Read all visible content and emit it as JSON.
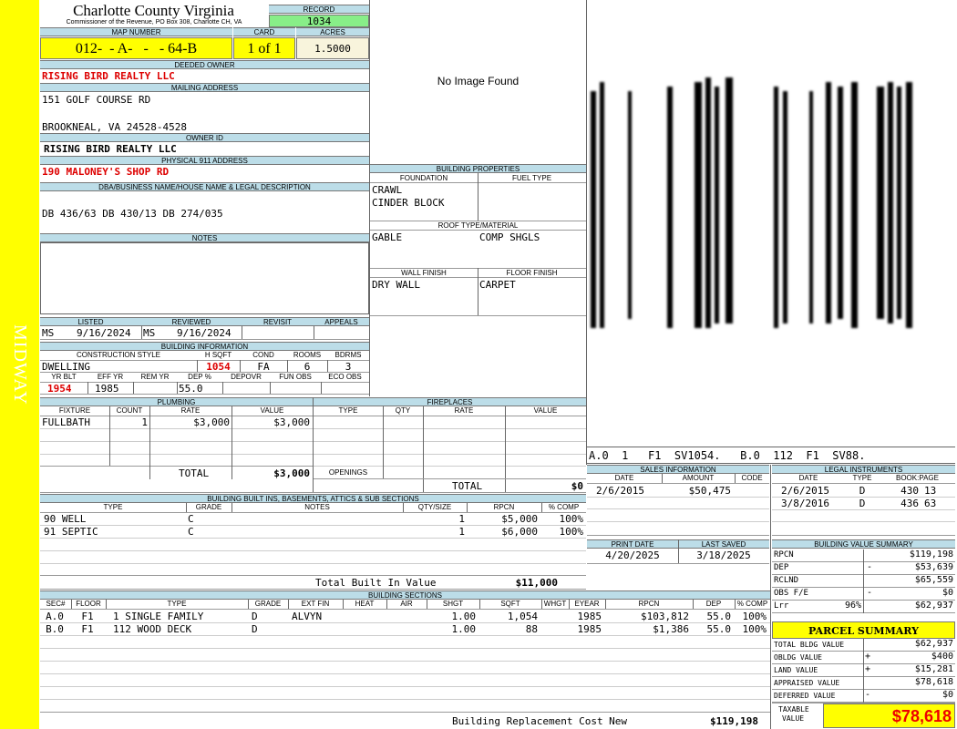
{
  "side_label": "MIDWAY",
  "header": {
    "county": "Charlotte County Virginia",
    "subtitle": "Commissioner of the Revenue, PO Box 308, Charlotte CH, VA",
    "record_label": "RECORD",
    "record": "1034",
    "map_label": "MAP NUMBER",
    "map_number": "012-  - A-   -   - 64-B",
    "card_label": "CARD",
    "card": "1 of 1",
    "acres_label": "ACRES",
    "acres": "1.5000"
  },
  "owner": {
    "deeded_label": "DEEDED OWNER",
    "deeded": "RISING BIRD REALTY LLC",
    "mailing_label": "MAILING ADDRESS",
    "mailing_line1": "151 GOLF COURSE RD",
    "mailing_line2": "BROOKNEAL, VA 24528-4528",
    "owner_id_label": "OWNER ID",
    "owner_id": "RISING BIRD REALTY LLC",
    "physical_label": "PHYSICAL 911 ADDRESS",
    "physical": "190 MALONEY'S SHOP RD",
    "dba_label": "DBA/BUSINESS NAME/HOUSE NAME & LEGAL DESCRIPTION",
    "dba": "DB 436/63 DB 430/13 DB 274/035",
    "notes_label": "NOTES",
    "notes": ""
  },
  "image": {
    "placeholder": "No Image Found"
  },
  "sketch": {
    "caption": "A.0  1   F1  SV1054.   B.0  112  F1  SV88."
  },
  "building_properties": {
    "title": "BUILDING PROPERTIES",
    "foundation_label": "FOUNDATION",
    "foundation1": "CRAWL",
    "foundation2": "CINDER BLOCK",
    "fuel_label": "FUEL TYPE",
    "fuel": "",
    "roof_label": "ROOF TYPE/MATERIAL",
    "roof_type": "GABLE",
    "roof_material": "COMP SHGLS",
    "wall_label": "WALL FINISH",
    "wall": "DRY WALL",
    "floor_label": "FLOOR FINISH",
    "floor": "CARPET"
  },
  "listing": {
    "listed_label": "LISTED",
    "listed_by": "MS",
    "listed_date": "9/16/2024",
    "reviewed_label": "REVIEWED",
    "reviewed_by": "MS",
    "reviewed_date": "9/16/2024",
    "revisit_label": "REVISIT",
    "appeals_label": "APPEALS"
  },
  "building_info": {
    "title": "BUILDING INFORMATION",
    "style_label": "CONSTRUCTION STYLE",
    "style": "DWELLING",
    "hsqft_label": "H SQFT",
    "hsqft": "1054",
    "cond_label": "COND",
    "cond": "FA",
    "rooms_label": "ROOMS",
    "rooms": "6",
    "bdrms_label": "BDRMS",
    "bdrms": "3",
    "yrblt_label": "YR BLT",
    "yrblt": "1954",
    "effyr_label": "EFF YR",
    "effyr": "1985",
    "remyr_label": "REM YR",
    "dep_label": "DEP %",
    "dep": "55.0",
    "depovr_label": "DEPOVR",
    "funobs_label": "FUN OBS",
    "ecoobs_label": "ECO OBS"
  },
  "plumbing": {
    "title": "PLUMBING",
    "cols": [
      "FIXTURE",
      "COUNT",
      "RATE",
      "VALUE"
    ],
    "rows": [
      {
        "fixture": "FULLBATH",
        "count": "1",
        "rate": "$3,000",
        "value": "$3,000"
      }
    ],
    "total_label": "TOTAL",
    "total": "$3,000"
  },
  "fireplaces": {
    "title": "FIREPLACES",
    "cols": [
      "TYPE",
      "QTY",
      "RATE",
      "VALUE"
    ],
    "openings_label": "OPENINGS",
    "total_label": "TOTAL",
    "total": "$0"
  },
  "sales": {
    "title": "SALES INFORMATION",
    "cols": [
      "DATE",
      "AMOUNT",
      "CODE"
    ],
    "rows": [
      {
        "date": "2/6/2015",
        "amount": "$50,475",
        "code": ""
      }
    ]
  },
  "legal": {
    "title": "LEGAL INSTRUMENTS",
    "cols": [
      "DATE",
      "TYPE",
      "BOOK:PAGE"
    ],
    "rows": [
      {
        "date": "2/6/2015",
        "type": "D",
        "book": "430",
        "page": "13"
      },
      {
        "date": "3/8/2016",
        "type": "D",
        "book": "436",
        "page": "63"
      }
    ]
  },
  "print": {
    "print_label": "PRINT DATE",
    "print_date": "4/20/2025",
    "saved_label": "LAST SAVED",
    "saved_date": "3/18/2025"
  },
  "built_ins": {
    "title": "BUILDING BUILT INS, BASEMENTS, ATTICS & SUB SECTIONS",
    "cols": [
      "TYPE",
      "GRADE",
      "NOTES",
      "QTY/SIZE",
      "RPCN",
      "% COMP"
    ],
    "rows": [
      {
        "type": "90 WELL",
        "grade": "C",
        "notes": "",
        "qty": "1",
        "rpcn": "$5,000",
        "comp": "100%"
      },
      {
        "type": "91 SEPTIC",
        "grade": "C",
        "notes": "",
        "qty": "1",
        "rpcn": "$6,000",
        "comp": "100%"
      }
    ],
    "total_label": "Total Built In Value",
    "total": "$11,000"
  },
  "value_summary": {
    "title": "BUILDING VALUE SUMMARY",
    "rows": [
      {
        "label": "RPCN",
        "sign": "",
        "pct": "",
        "value": "$119,198"
      },
      {
        "label": "DEP",
        "sign": "-",
        "pct": "",
        "value": "$53,639"
      },
      {
        "label": "RCLND",
        "sign": "",
        "pct": "",
        "value": "$65,559"
      },
      {
        "label": "OBS F/E",
        "sign": "-",
        "pct": "",
        "value": "$0"
      },
      {
        "label": "Lrr",
        "sign": "",
        "pct": "96%",
        "value": "$62,937"
      }
    ]
  },
  "sections": {
    "title": "BUILDING SECTIONS",
    "cols": [
      "SEC#",
      "FLOOR",
      "TYPE",
      "GRADE",
      "EXT FIN",
      "HEAT",
      "AIR",
      "SHGT",
      "SQFT",
      "WHGT",
      "EYEAR",
      "RPCN",
      "DEP",
      "% COMP"
    ],
    "rows": [
      {
        "sec": "A.0",
        "floor": "F1",
        "type": "1 SINGLE FAMILY",
        "grade": "D",
        "ext": "ALVYN",
        "heat": "",
        "air": "",
        "shgt": "1.00",
        "sqft": "1,054",
        "whgt": "",
        "eyear": "1985",
        "rpcn": "$103,812",
        "dep": "55.0",
        "comp": "100%"
      },
      {
        "sec": "B.0",
        "floor": "F1",
        "type": "112 WOOD DECK",
        "grade": "D",
        "ext": "",
        "heat": "",
        "air": "",
        "shgt": "1.00",
        "sqft": "88",
        "whgt": "",
        "eyear": "1985",
        "rpcn": "$1,386",
        "dep": "55.0",
        "comp": "100%"
      }
    ],
    "total_label": "Building Replacement Cost New",
    "total": "$119,198"
  },
  "parcel_summary": {
    "title": "PARCEL SUMMARY",
    "rows": [
      {
        "label": "TOTAL BLDG VALUE",
        "sign": "",
        "value": "$62,937"
      },
      {
        "label": "OBLDG VALUE",
        "sign": "+",
        "value": "$400"
      },
      {
        "label": "LAND VALUE",
        "sign": "+",
        "value": "$15,281"
      },
      {
        "label": "APPRAISED VALUE",
        "sign": "",
        "value": "$78,618"
      },
      {
        "label": "DEFERRED VALUE",
        "sign": "-",
        "value": "$0"
      }
    ],
    "taxable_label1": "TAXABLE",
    "taxable_label2": "VALUE",
    "taxable": "$78,618"
  }
}
